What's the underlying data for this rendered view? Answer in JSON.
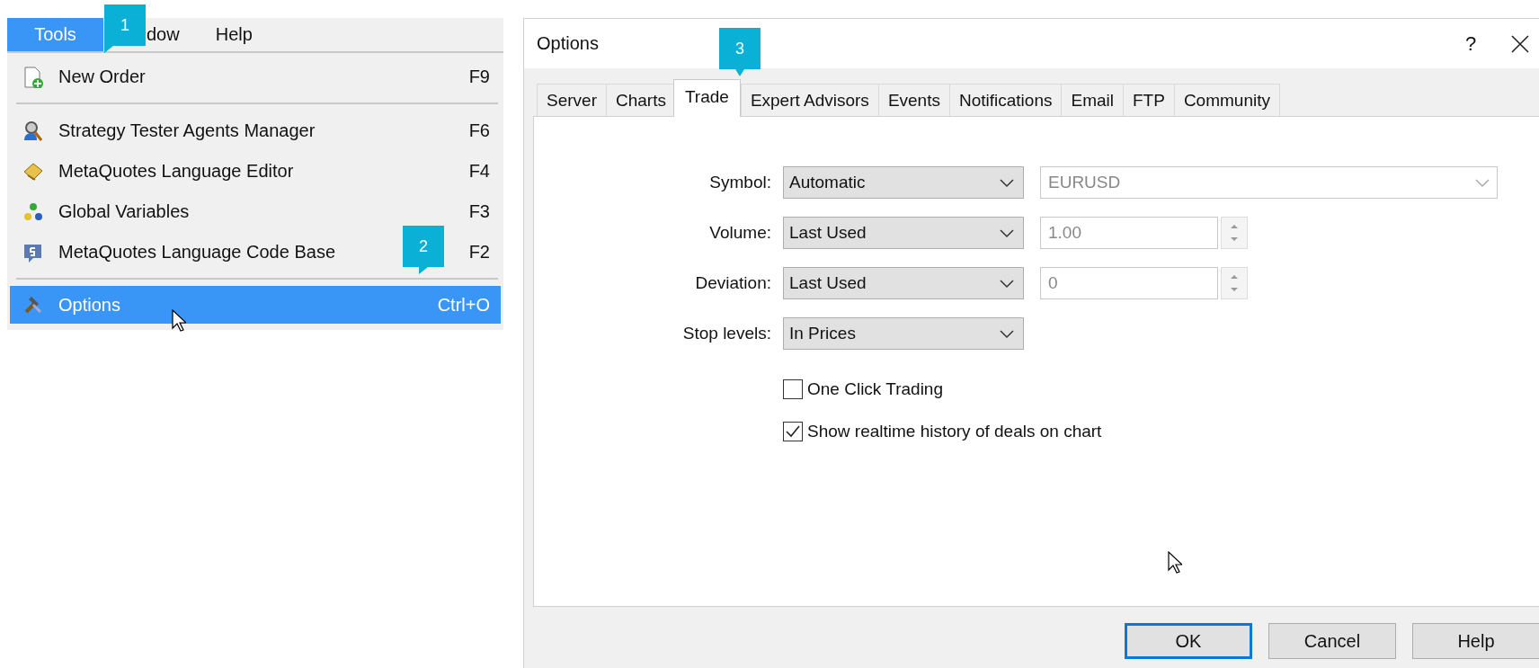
{
  "menu_bar": [
    {
      "label": "Tools",
      "selected": true
    },
    {
      "label": "dow",
      "selected": false
    },
    {
      "label": "Help",
      "selected": false
    }
  ],
  "menu": {
    "groups": [
      [
        {
          "label": "New Order",
          "shortcut": "F9",
          "selected": false
        }
      ],
      [
        {
          "label": "Strategy Tester Agents Manager",
          "shortcut": "F6",
          "selected": false
        },
        {
          "label": "MetaQuotes Language Editor",
          "shortcut": "F4",
          "selected": false
        },
        {
          "label": "Global Variables",
          "shortcut": "F3",
          "selected": false
        },
        {
          "label": "MetaQuotes Language Code Base",
          "shortcut": "F2",
          "selected": false
        }
      ],
      [
        {
          "label": "Options",
          "shortcut": "Ctrl+O",
          "selected": true
        }
      ]
    ]
  },
  "badges": [
    {
      "text": "1"
    },
    {
      "text": "2"
    },
    {
      "text": "3"
    }
  ],
  "dialog": {
    "title": "Options",
    "help": "?",
    "tabs": [
      {
        "label": "Server",
        "selected": false
      },
      {
        "label": "Charts",
        "selected": false
      },
      {
        "label": "Trade",
        "selected": true
      },
      {
        "label": "Expert Advisors",
        "selected": false
      },
      {
        "label": "Events",
        "selected": false
      },
      {
        "label": "Notifications",
        "selected": false
      },
      {
        "label": "Email",
        "selected": false
      },
      {
        "label": "FTP",
        "selected": false
      },
      {
        "label": "Community",
        "selected": false
      }
    ],
    "rows": [
      {
        "label": "Symbol:",
        "value": "Automatic",
        "kind": "combo",
        "field": {
          "value": "EURUSD",
          "disabled": true
        }
      },
      {
        "label": "Volume:",
        "value": "Last Used",
        "kind": "spin",
        "field": {
          "value": "1.00",
          "disabled": true
        }
      },
      {
        "label": "Deviation:",
        "value": "Last Used",
        "kind": "spin",
        "field": {
          "value": "0",
          "disabled": true
        }
      },
      {
        "label": "Stop levels:",
        "value": "In Prices",
        "kind": "plain"
      }
    ],
    "checkboxes": [
      {
        "label": "One Click Trading",
        "checked": false
      },
      {
        "label": "Show realtime history of deals on chart",
        "checked": true
      }
    ],
    "buttons": [
      {
        "label": "OK",
        "default": true
      },
      {
        "label": "Cancel",
        "default": false
      },
      {
        "label": "Help",
        "default": false
      }
    ]
  }
}
